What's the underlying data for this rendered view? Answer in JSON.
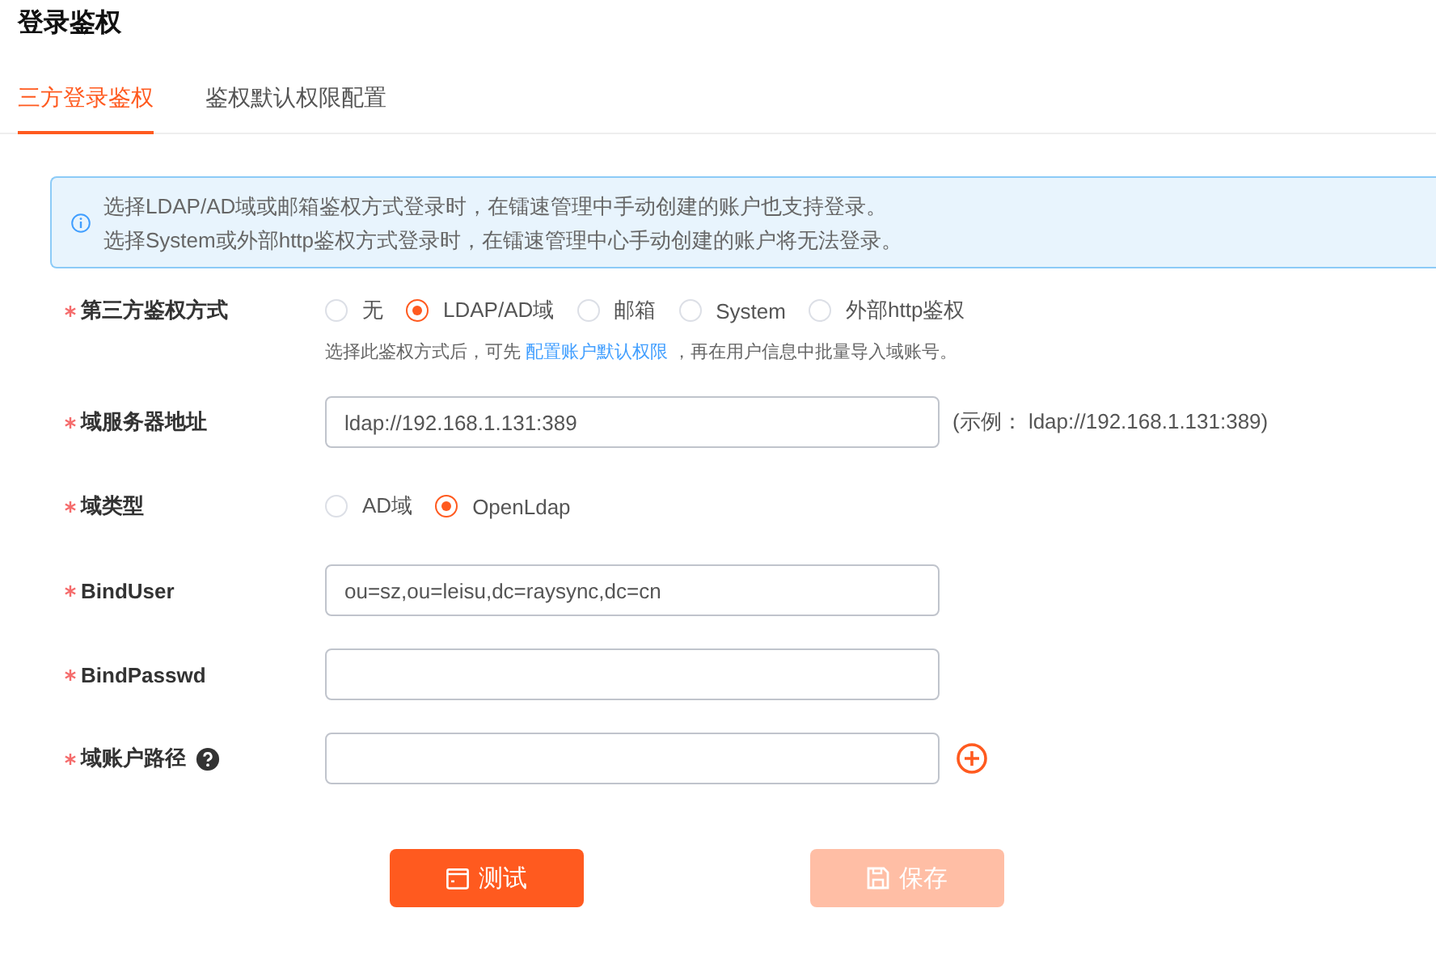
{
  "title": "登录鉴权",
  "tabs": [
    {
      "label": "三方登录鉴权",
      "selected": true
    },
    {
      "label": "鉴权默认权限配置",
      "selected": false
    }
  ],
  "notice": {
    "lines": [
      "选择LDAP/AD域或邮箱鉴权方式登录时，在镭速管理中手动创建的账户也支持登录。",
      "选择System或外部http鉴权方式登录时，在镭速管理中心手动创建的账户将无法登录。"
    ]
  },
  "form": {
    "fields": [
      {
        "kind": "radio",
        "label": "第三方鉴权方式",
        "required": true,
        "options": [
          {
            "label": "无",
            "selected": false
          },
          {
            "label": "LDAP/AD域",
            "selected": true
          },
          {
            "label": "邮箱",
            "selected": false
          },
          {
            "label": "System",
            "selected": false
          },
          {
            "label": "外部http鉴权",
            "selected": false
          }
        ],
        "hint": {
          "before": "选择此鉴权方式后，可先",
          "link": "配置账户默认权限",
          "after": "，再在用户信息中批量导入域账号。"
        }
      },
      {
        "kind": "text",
        "label": "域服务器地址",
        "required": true,
        "value": "ldap://192.168.1.131:389",
        "suffix": "(示例： ldap://192.168.1.131:389)"
      },
      {
        "kind": "radio",
        "label": "域类型",
        "required": true,
        "options": [
          {
            "label": "AD域",
            "selected": false
          },
          {
            "label": "OpenLdap",
            "selected": true
          }
        ]
      },
      {
        "kind": "text",
        "label": "BindUser",
        "required": true,
        "value": "ou=sz,ou=leisu,dc=raysync,dc=cn"
      },
      {
        "kind": "text",
        "label": "BindPasswd",
        "required": true
      },
      {
        "kind": "text",
        "label": "域账户路径",
        "required": true,
        "help": true,
        "addable": true
      }
    ]
  },
  "buttons": [
    {
      "label": "测试",
      "kind": "test",
      "disabled": false
    },
    {
      "label": "保存",
      "kind": "save",
      "disabled": true
    }
  ]
}
